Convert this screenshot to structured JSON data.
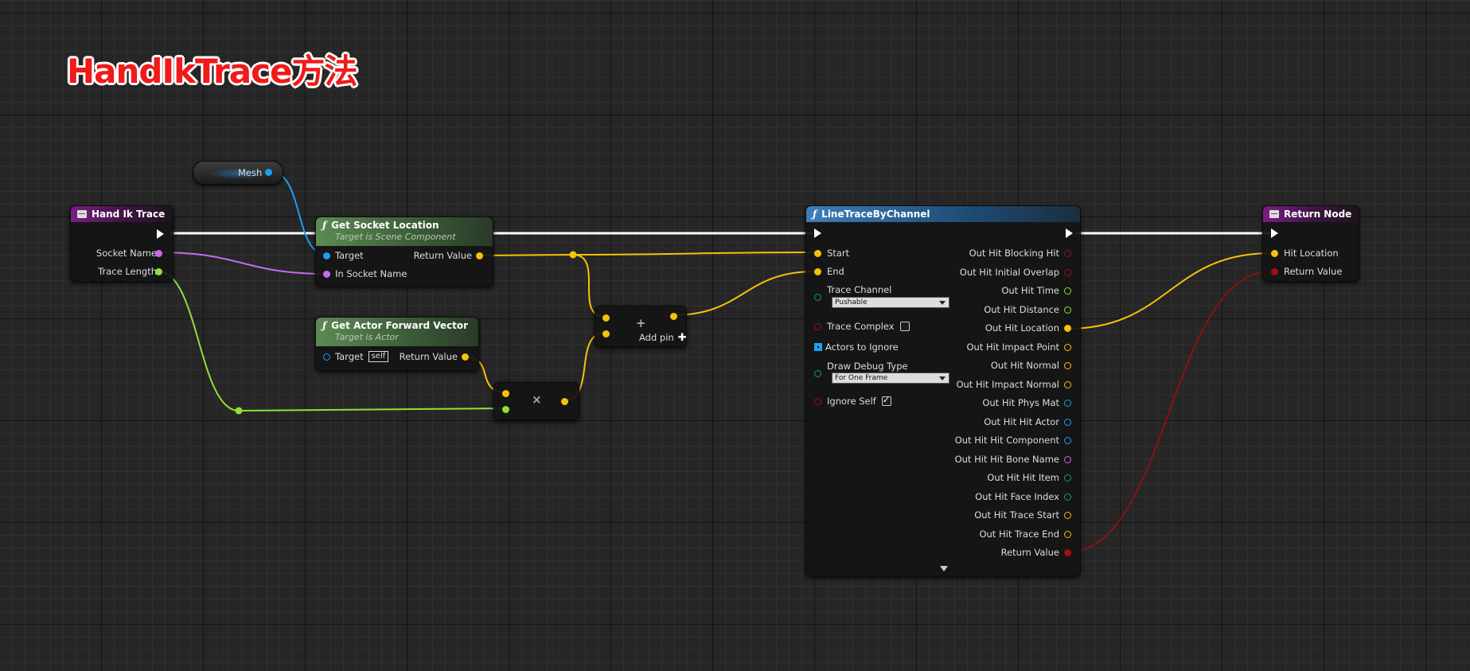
{
  "title": "HandIkTrace方法",
  "colors": {
    "exec": "#ffffff",
    "object": "#1aa0f0",
    "name": "#c46bf0",
    "float": "#8ee03a",
    "vector": "#f5c20a",
    "bool": "#a01010",
    "struct": "#1aa0f0",
    "byte": "#0ca080"
  },
  "nodes": {
    "hand_ik_trace": {
      "title": "Hand Ik Trace",
      "pins": [
        "Socket Name",
        "Trace Length"
      ]
    },
    "mesh_var": {
      "label": "Mesh"
    },
    "get_socket_location": {
      "title": "Get Socket Location",
      "subtitle": "Target is Scene Component",
      "inputs": [
        "Target",
        "In Socket Name"
      ],
      "output": "Return Value"
    },
    "get_actor_forward_vector": {
      "title": "Get Actor Forward Vector",
      "subtitle": "Target is Actor",
      "input": "Target",
      "input_default": "self",
      "output": "Return Value"
    },
    "multiply": {
      "symbol": "×"
    },
    "add": {
      "symbol": "+",
      "add_pin": "Add pin"
    },
    "line_trace": {
      "title": "LineTraceByChannel",
      "inputs": {
        "start": "Start",
        "end": "End",
        "trace_channel": "Trace Channel",
        "trace_channel_value": "Pushable",
        "trace_complex": "Trace Complex",
        "actors_to_ignore": "Actors to Ignore",
        "draw_debug_type": "Draw Debug Type",
        "draw_debug_value": "For One Frame",
        "ignore_self": "Ignore Self"
      },
      "trace_complex_checked": false,
      "ignore_self_checked": true,
      "outputs": [
        {
          "label": "Out Hit Blocking Hit",
          "color": "#a01010"
        },
        {
          "label": "Out Hit Initial Overlap",
          "color": "#a01010"
        },
        {
          "label": "Out Hit Time",
          "color": "#8ee03a"
        },
        {
          "label": "Out Hit Distance",
          "color": "#8ee03a"
        },
        {
          "label": "Out Hit Location",
          "color": "#f5c20a"
        },
        {
          "label": "Out Hit Impact Point",
          "color": "#f5c20a"
        },
        {
          "label": "Out Hit Normal",
          "color": "#f5c20a"
        },
        {
          "label": "Out Hit Impact Normal",
          "color": "#f5c20a"
        },
        {
          "label": "Out Hit Phys Mat",
          "color": "#1aa0f0"
        },
        {
          "label": "Out Hit Hit Actor",
          "color": "#1aa0f0"
        },
        {
          "label": "Out Hit Hit Component",
          "color": "#1aa0f0"
        },
        {
          "label": "Out Hit Hit Bone Name",
          "color": "#c46bf0"
        },
        {
          "label": "Out Hit Hit Item",
          "color": "#0ca080"
        },
        {
          "label": "Out Hit Face Index",
          "color": "#0ca080"
        },
        {
          "label": "Out Hit Trace Start",
          "color": "#f5c20a"
        },
        {
          "label": "Out Hit Trace End",
          "color": "#f5c20a"
        },
        {
          "label": "Return Value",
          "color": "#a01010"
        }
      ]
    },
    "return_node": {
      "title": "Return Node",
      "pins": [
        "Hit Location",
        "Return Value"
      ]
    }
  }
}
